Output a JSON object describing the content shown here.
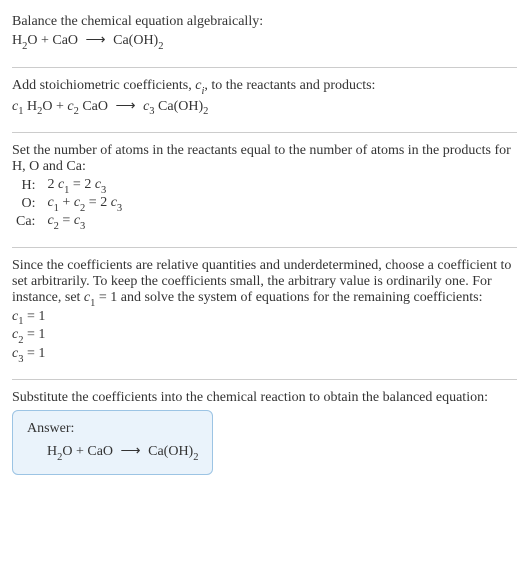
{
  "section1": {
    "line1": "Balance the chemical equation algebraically:"
  },
  "eq1": {
    "r1a": "H",
    "r1b": "2",
    "r1c": "O + CaO ",
    "arrow": "⟶",
    "p1a": " Ca(OH)",
    "p1b": "2"
  },
  "section2": {
    "line1_a": "Add stoichiometric coefficients, ",
    "line1_b": "c",
    "line1_c": "i",
    "line1_d": ", to the reactants and products:"
  },
  "eq2": {
    "c1a": "c",
    "c1b": "1",
    "sp1": " H",
    "sp1s": "2",
    "sp1e": "O + ",
    "c2a": "c",
    "c2b": "2",
    "sp2": " CaO ",
    "arrow": "⟶ ",
    "c3a": "c",
    "c3b": "3",
    "sp3": " Ca(OH)",
    "sp3s": "2"
  },
  "section3": {
    "line1": "Set the number of atoms in the reactants equal to the number of atoms in the products for H, O and Ca:"
  },
  "atoms": {
    "h_label": "H:",
    "h_eq_a": "2 ",
    "h_eq_b": "c",
    "h_eq_c": "1",
    "h_eq_d": " = 2 ",
    "h_eq_e": "c",
    "h_eq_f": "3",
    "o_label": "O:",
    "o_eq_a": "c",
    "o_eq_b": "1",
    "o_eq_c": " + ",
    "o_eq_d": "c",
    "o_eq_e": "2",
    "o_eq_f": " = 2 ",
    "o_eq_g": "c",
    "o_eq_h": "3",
    "ca_label": "Ca:",
    "ca_eq_a": "c",
    "ca_eq_b": "2",
    "ca_eq_c": " = ",
    "ca_eq_d": "c",
    "ca_eq_e": "3"
  },
  "section4": {
    "line1_a": "Since the coefficients are relative quantities and underdetermined, choose a coefficient to set arbitrarily. To keep the coefficients small, the arbitrary value is ordinarily one. For instance, set ",
    "line1_b": "c",
    "line1_c": "1",
    "line1_d": " = 1 and solve the system of equations for the remaining coefficients:"
  },
  "coeffs": {
    "c1_a": "c",
    "c1_b": "1",
    "c1_c": " = 1",
    "c2_a": "c",
    "c2_b": "2",
    "c2_c": " = 1",
    "c3_a": "c",
    "c3_b": "3",
    "c3_c": " = 1"
  },
  "section5": {
    "line1": "Substitute the coefficients into the chemical reaction to obtain the balanced equation:"
  },
  "answer": {
    "label": "Answer:",
    "r1a": "H",
    "r1b": "2",
    "r1c": "O + CaO ",
    "arrow": "⟶",
    "p1a": " Ca(OH)",
    "p1b": "2"
  }
}
